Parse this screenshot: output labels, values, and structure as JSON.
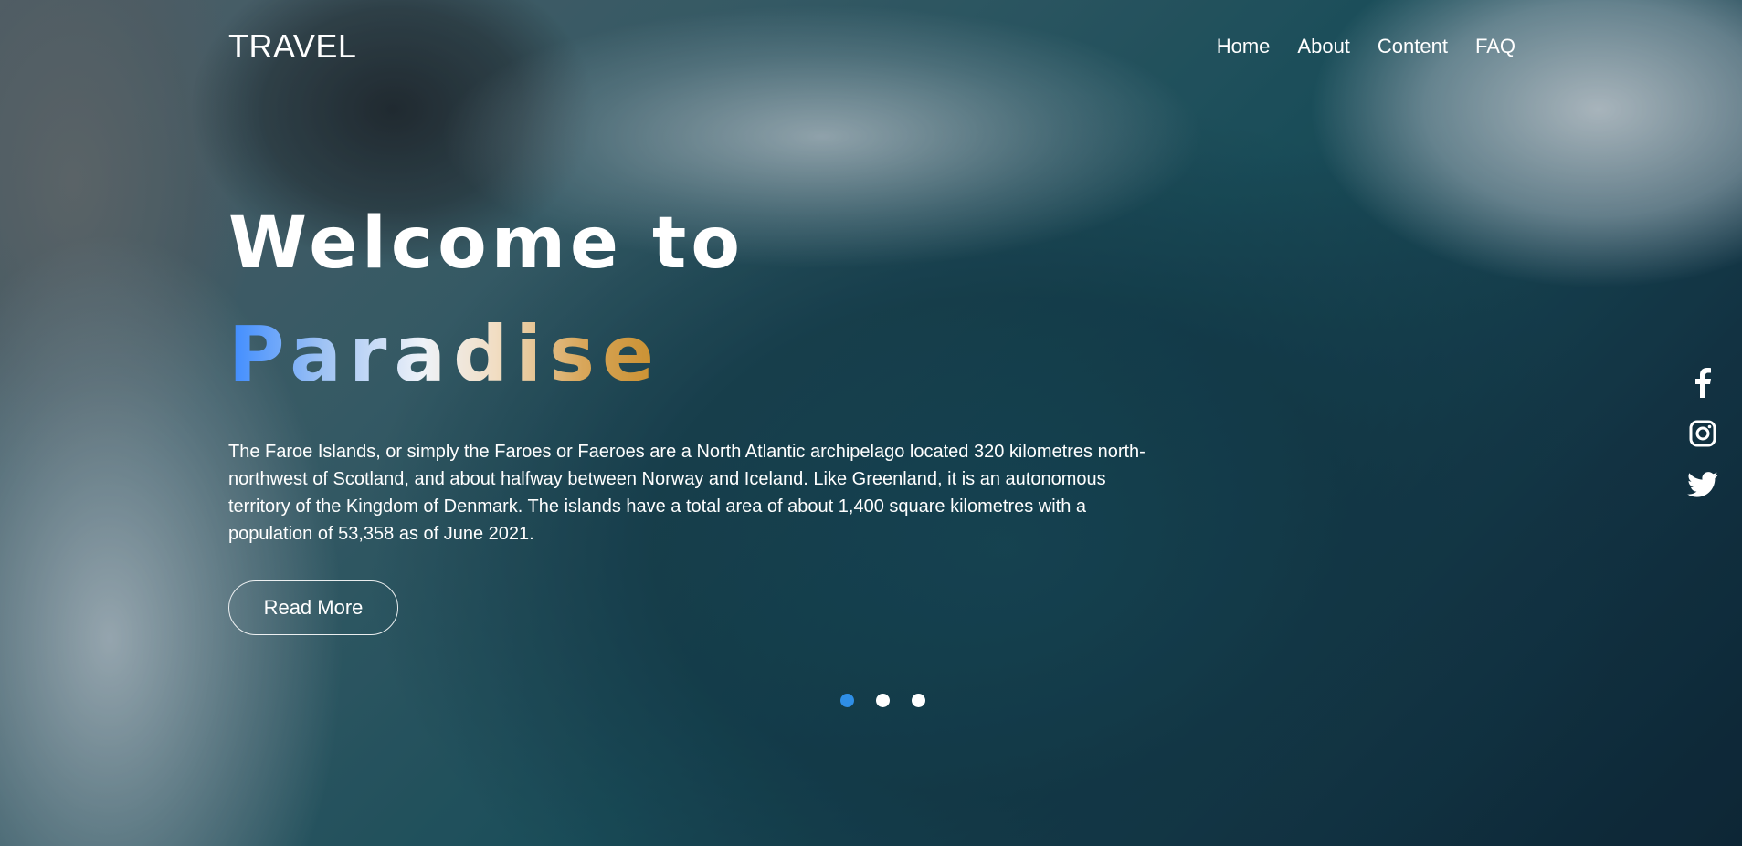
{
  "header": {
    "logo": "TRAVEL",
    "nav": [
      "Home",
      "About",
      "Content",
      "FAQ"
    ]
  },
  "hero": {
    "headline": "Welcome to",
    "subheadline": "Paradise",
    "description": "The Faroe Islands, or simply the Faroes or Faeroes are a North Atlantic archipelago located 320 kilometres north-northwest of Scotland, and about halfway between Norway and Iceland. Like Greenland, it is an autonomous territory of the Kingdom of Denmark. The islands have a total area of about 1,400 square kilometres with a population of 53,358 as of June 2021.",
    "button_label": "Read More"
  },
  "social": [
    "facebook-icon",
    "instagram-icon",
    "twitter-icon"
  ],
  "slider": {
    "count": 3,
    "active_index": 0,
    "active_color": "#2f8ee6"
  },
  "colors": {
    "text": "#ffffff",
    "gradient_stops": [
      "#3d8bff",
      "#eef2f8",
      "#c98f2e"
    ]
  }
}
